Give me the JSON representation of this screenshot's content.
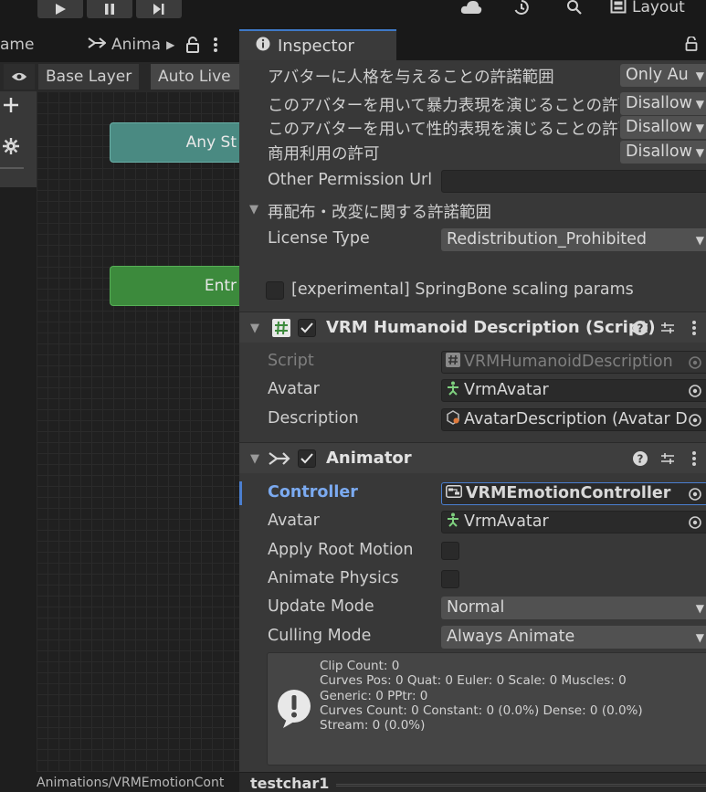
{
  "toolbar": {
    "play": "play-icon",
    "pause": "pause-icon",
    "step": "step-icon",
    "layout_label": "Layout"
  },
  "left_panel": {
    "tab_fragment": "ame",
    "animator_tab_label": "Anima",
    "breadcrumb_base_layer": "Base Layer",
    "auto_live_label": "Auto Live",
    "nodes": {
      "any_state": "Any St",
      "entry": "Entr"
    },
    "status_path": "Animations/VRMEmotionCont"
  },
  "inspector": {
    "tab_label": "Inspector",
    "meta": {
      "rows": [
        {
          "label": "アバターに人格を与えることの許諾範囲",
          "value": "Only Au"
        },
        {
          "label": "このアバターを用いて暴力表現を演じることの許可",
          "value": "Disallow"
        },
        {
          "label": "このアバターを用いて性的表現を演じることの許可",
          "value": "Disallow"
        },
        {
          "label": "商用利用の許可",
          "value": "Disallow"
        }
      ],
      "other_permission_label": "Other Permission Url",
      "other_permission_value": "",
      "redistribution_section": "再配布・改変に関する許諾範囲",
      "license_type_label": "License Type",
      "license_type_value": "Redistribution_Prohibited",
      "experimental_label": "[experimental] SpringBone scaling params"
    },
    "humanoid": {
      "title": "VRM Humanoid Description (Script)",
      "script_label": "Script",
      "script_value": "VRMHumanoidDescription",
      "avatar_label": "Avatar",
      "avatar_value": "VrmAvatar",
      "description_label": "Description",
      "description_value": "AvatarDescription (Avatar D"
    },
    "animator": {
      "title": "Animator",
      "controller_label": "Controller",
      "controller_value": "VRMEmotionController",
      "avatar_label": "Avatar",
      "avatar_value": "VrmAvatar",
      "apply_root_motion_label": "Apply Root Motion",
      "animate_physics_label": "Animate Physics",
      "update_mode_label": "Update Mode",
      "update_mode_value": "Normal",
      "culling_mode_label": "Culling Mode",
      "culling_mode_value": "Always Animate",
      "info_lines": [
        "Clip Count: 0",
        "Curves Pos: 0 Quat: 0 Euler: 0 Scale: 0 Muscles: 0",
        "Generic: 0 PPtr: 0",
        "Curves Count: 0 Constant: 0 (0.0%) Dense: 0 (0.0%)",
        "Stream: 0 (0.0%)"
      ]
    },
    "footer_name": "testchar1"
  },
  "colors": {
    "accent_blue": "#3f79c7",
    "any_state_node": "#4a8a82",
    "entry_node": "#3c8a3c"
  }
}
